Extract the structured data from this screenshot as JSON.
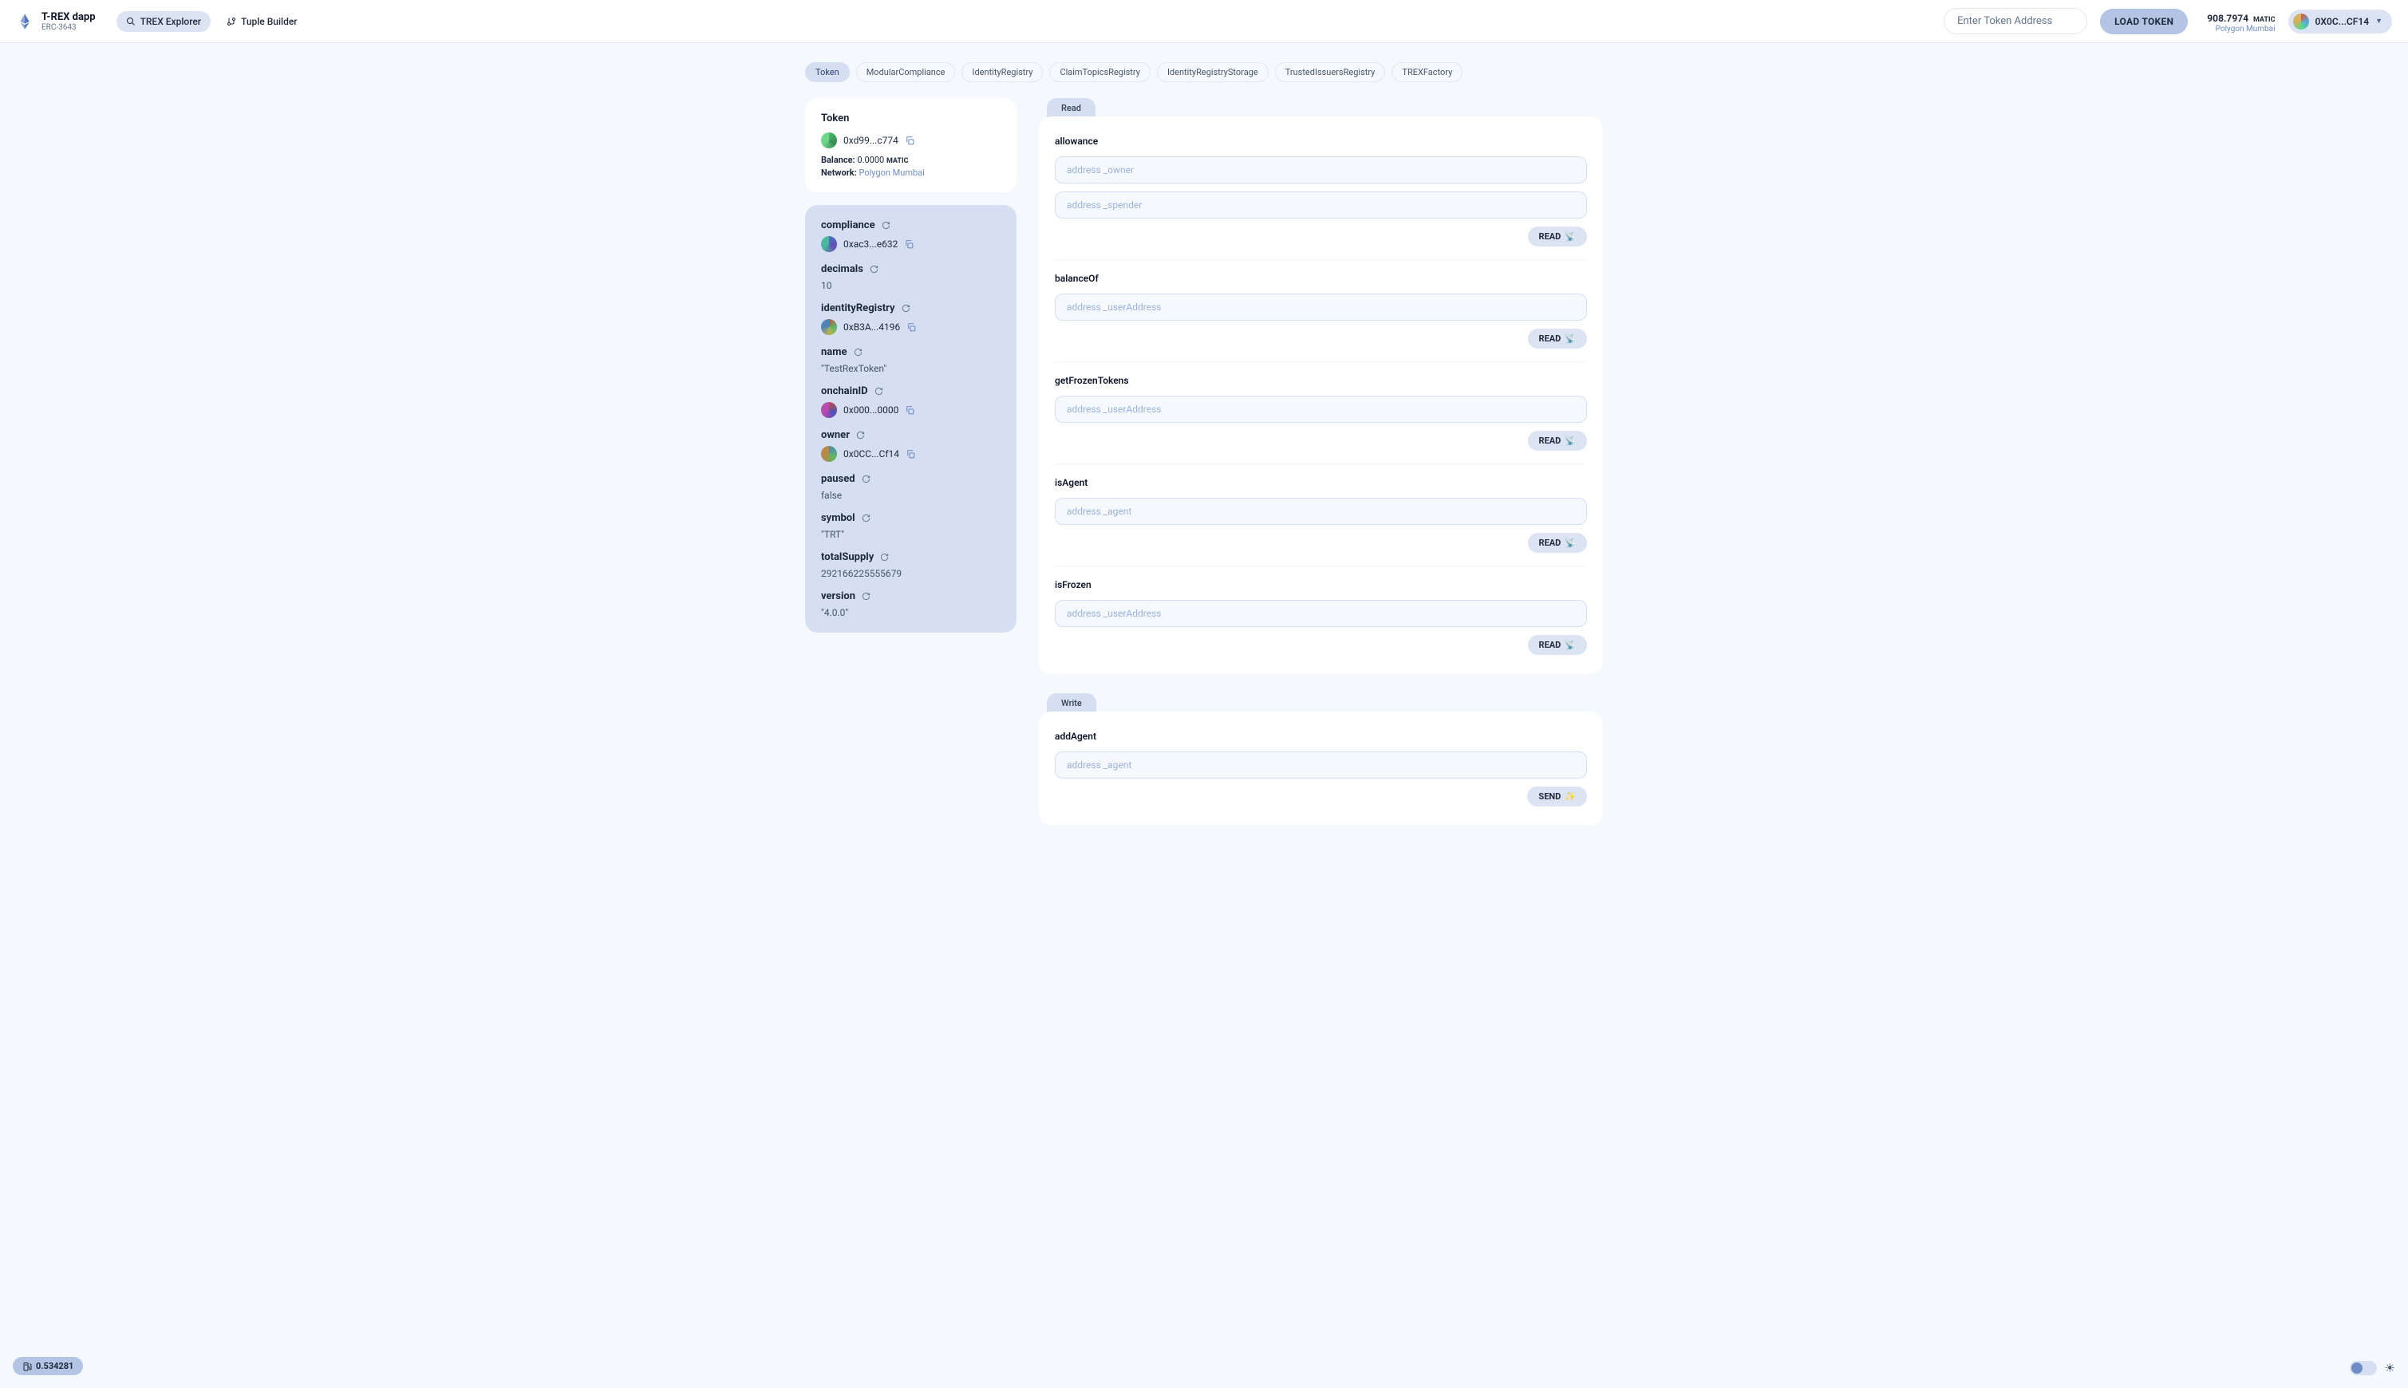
{
  "header": {
    "brand_title": "T-REX dapp",
    "brand_subtitle": "ERC-3643",
    "nav": [
      {
        "label": "TREX Explorer"
      },
      {
        "label": "Tuple Builder"
      }
    ],
    "token_input_placeholder": "Enter Token Address",
    "load_button": "LOAD TOKEN",
    "balance_amount": "908.7974",
    "balance_unit": "MATIC",
    "balance_network": "Polygon Mumbai",
    "wallet_short": "0X0C...CF14"
  },
  "tabs": [
    "Token",
    "ModularCompliance",
    "IdentityRegistry",
    "ClaimTopicsRegistry",
    "IdentityRegistryStorage",
    "TrustedIssuersRegistry",
    "TREXFactory"
  ],
  "tabs_active_index": 0,
  "token_card": {
    "title": "Token",
    "address_short": "0xd99...c774",
    "balance_label": "Balance:",
    "balance_value": "0.0000",
    "balance_unit": "MATIC",
    "network_label": "Network:",
    "network_value": "Polygon Mumbai"
  },
  "properties": [
    {
      "name": "compliance",
      "type": "address",
      "address_short": "0xac3...e632"
    },
    {
      "name": "decimals",
      "type": "value",
      "value": "10"
    },
    {
      "name": "identityRegistry",
      "type": "address",
      "address_short": "0xB3A...4196"
    },
    {
      "name": "name",
      "type": "value",
      "value": "\"TestRexToken\""
    },
    {
      "name": "onchainID",
      "type": "address",
      "address_short": "0x000...0000"
    },
    {
      "name": "owner",
      "type": "address",
      "address_short": "0x0CC...Cf14"
    },
    {
      "name": "paused",
      "type": "value",
      "value": "false"
    },
    {
      "name": "symbol",
      "type": "value",
      "value": "\"TRT\""
    },
    {
      "name": "totalSupply",
      "type": "value",
      "value": "292166225555679"
    },
    {
      "name": "version",
      "type": "value",
      "value": "\"4.0.0\""
    }
  ],
  "read_label": "Read",
  "read_button": "READ",
  "read_functions": [
    {
      "name": "allowance",
      "inputs": [
        "address _owner",
        "address _spender"
      ]
    },
    {
      "name": "balanceOf",
      "inputs": [
        "address _userAddress"
      ]
    },
    {
      "name": "getFrozenTokens",
      "inputs": [
        "address _userAddress"
      ]
    },
    {
      "name": "isAgent",
      "inputs": [
        "address _agent"
      ]
    },
    {
      "name": "isFrozen",
      "inputs": [
        "address _userAddress"
      ]
    }
  ],
  "write_label": "Write",
  "send_button": "SEND",
  "write_functions": [
    {
      "name": "addAgent",
      "inputs": [
        "address _agent"
      ]
    }
  ],
  "gas_price": "0.534281"
}
